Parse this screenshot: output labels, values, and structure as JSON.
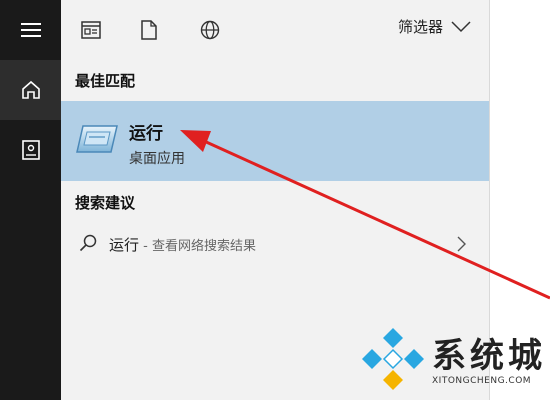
{
  "left_rail": {
    "items": [
      {
        "icon": "hamburger-menu-icon"
      },
      {
        "icon": "home-icon",
        "active": true
      },
      {
        "icon": "notebook-icon"
      }
    ]
  },
  "toolbar": {
    "icons": [
      "apps-icon",
      "document-icon",
      "web-globe-icon"
    ],
    "filter_label": "筛选器"
  },
  "best_match": {
    "heading": "最佳匹配",
    "app_name": "运行",
    "app_type": "桌面应用"
  },
  "search_suggestions": {
    "heading": "搜索建议",
    "query": "运行",
    "hint": " - 查看网络搜索结果"
  },
  "annotation": {
    "arrow_color": "#e02020"
  },
  "watermark": {
    "title": "系统城",
    "url": "XITONGCHENG.COM"
  }
}
